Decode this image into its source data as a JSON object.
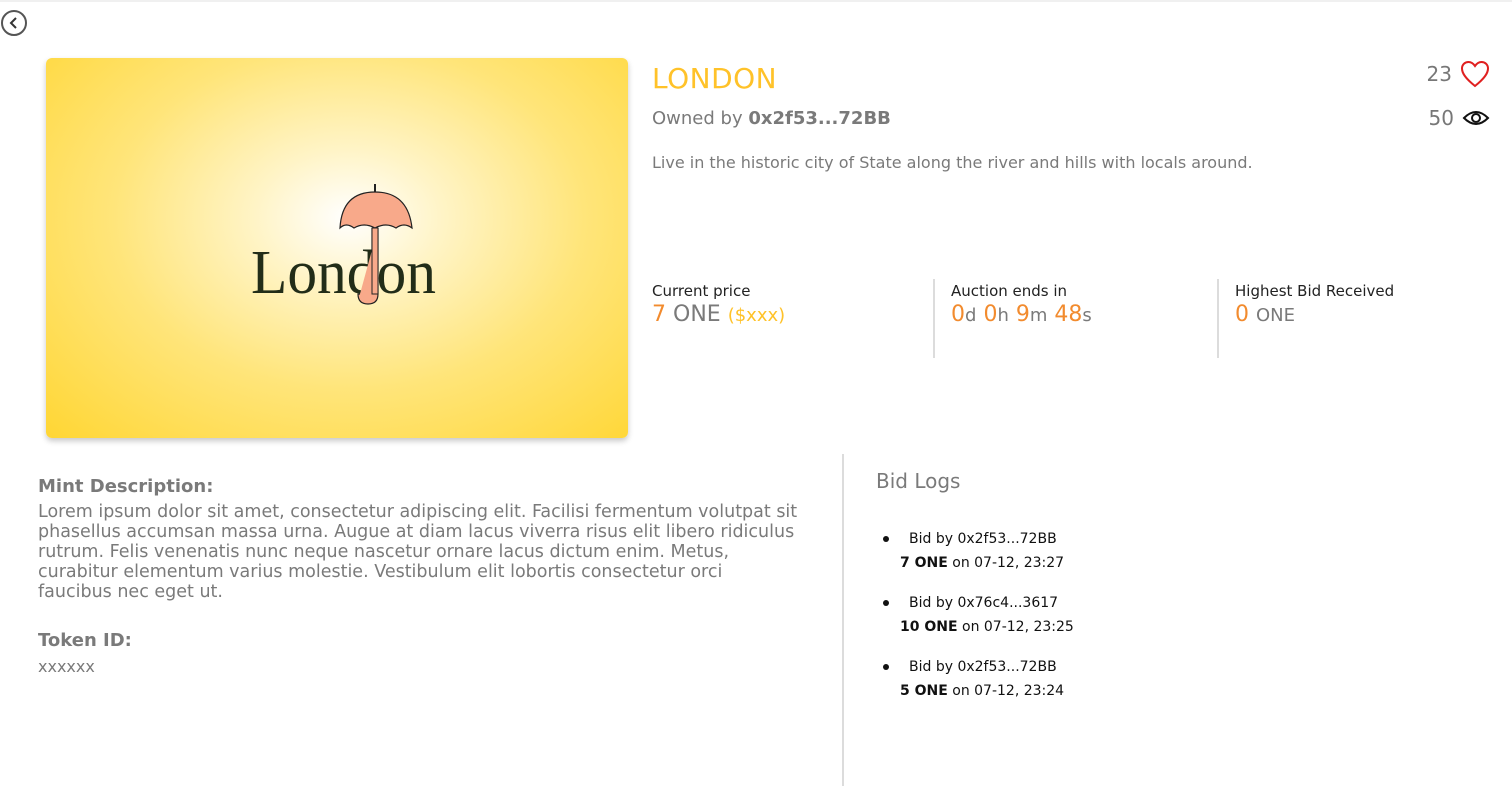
{
  "back": {
    "icon": "chevron-left-icon"
  },
  "hero": {
    "logo_text": "London",
    "icon": "umbrella-icon"
  },
  "item": {
    "title": "LONDON",
    "owned_by_label": "Owned by",
    "owner": "0x2f53...72BB",
    "description": "Live in the historic city of State along the river and hills with locals around."
  },
  "stats": {
    "likes": "23",
    "likes_icon": "heart-icon",
    "views": "50",
    "views_icon": "eye-icon"
  },
  "current_price": {
    "label": "Current price",
    "amount": "7",
    "currency": "ONE",
    "usd": "($xxx)"
  },
  "auction": {
    "label": "Auction ends in",
    "days": "0",
    "days_unit": "d",
    "hours": "0",
    "hours_unit": "h",
    "minutes": "9",
    "minutes_unit": "m",
    "seconds": "48",
    "seconds_unit": "s"
  },
  "highest_bid": {
    "label": "Highest Bid Received",
    "amount": "0",
    "currency": "ONE"
  },
  "mint": {
    "title": "Mint Description:",
    "body": "Lorem ipsum dolor sit amet, consectetur adipiscing elit. Facilisi fermentum volutpat sit phasellus accumsan massa urna. Augue at diam lacus viverra risus elit libero ridiculus rutrum. Felis venenatis nunc neque nascetur ornare lacus dictum enim. Metus, curabitur elementum varius molestie. Vestibulum elit lobortis consectetur orci faucibus nec eget ut."
  },
  "token": {
    "title": "Token ID:",
    "value": "xxxxxx"
  },
  "bid_logs": {
    "title": "Bid Logs",
    "items": [
      {
        "by": "Bid by 0x2f53...72BB",
        "amount": "7 ONE",
        "when": "on 07-12, 23:27"
      },
      {
        "by": "Bid by 0x76c4...3617",
        "amount": "10 ONE",
        "when": "on 07-12, 23:25"
      },
      {
        "by": "Bid by 0x2f53...72BB",
        "amount": "5 ONE",
        "when": "on 07-12, 23:24"
      }
    ]
  },
  "colors": {
    "accent": "#ffc229",
    "orange": "#f28b2e",
    "heart": "#e02020",
    "umbrella": "#f8a98a"
  }
}
